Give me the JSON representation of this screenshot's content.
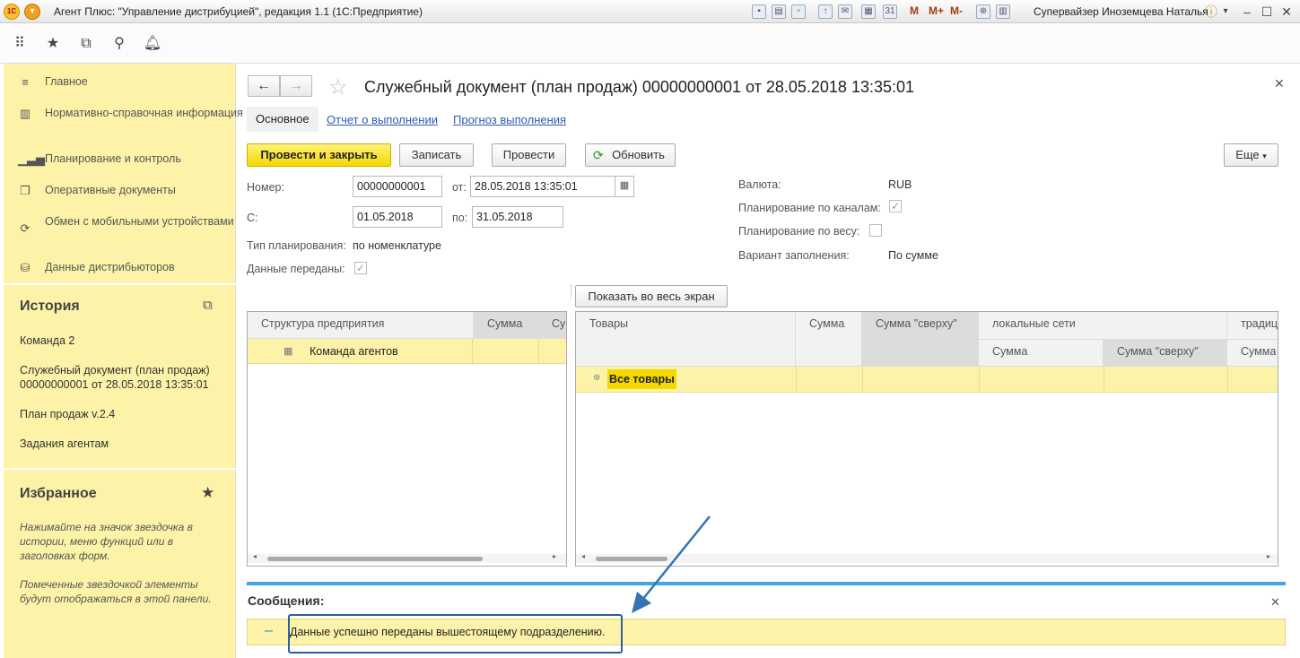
{
  "window": {
    "title": "Агент Плюс: \"Управление дистрибуцией\", редакция 1.1  (1С:Предприятие)",
    "logo_text": "1С",
    "user": "Супервайзер Иноземцева Наталья",
    "m_buttons": [
      "M",
      "M+",
      "M-"
    ]
  },
  "sidebar": {
    "items": [
      {
        "label": "Главное",
        "icon": "menu-icon"
      },
      {
        "label": "Нормативно-справочная информация",
        "icon": "reference-icon"
      },
      {
        "label": "Планирование и контроль",
        "icon": "chart-icon"
      },
      {
        "label": "Оперативные документы",
        "icon": "documents-icon"
      },
      {
        "label": "Обмен с мобильными устройствами",
        "icon": "sync-icon"
      },
      {
        "label": "Данные дистрибьюторов",
        "icon": "database-icon"
      }
    ],
    "history_title": "История",
    "history": [
      "Команда 2",
      "Служебный документ (план продаж) 00000000001 от 28.05.2018 13:35:01",
      "План продаж v.2.4",
      "Задания агентам"
    ],
    "favorites_title": "Избранное",
    "favorites_note1": "Нажимайте на значок звездочка в истории, меню функций или в заголовках форм.",
    "favorites_note2": "Помеченные звездочкой элементы будут отображаться в этой панели."
  },
  "document": {
    "title": "Служебный документ (план продаж) 00000000001 от 28.05.2018 13:35:01",
    "tabs": [
      "Основное",
      "Отчет о выполнении",
      "Прогноз выполнения"
    ],
    "buttons": {
      "post_close": "Провести и закрыть",
      "save": "Записать",
      "post": "Провести",
      "refresh": "Обновить",
      "more": "Еще"
    },
    "fields": {
      "number_label": "Номер:",
      "number": "00000000001",
      "date_label": "от:",
      "date": "28.05.2018 13:35:01",
      "from_label": "С:",
      "from": "01.05.2018",
      "to_label": "по:",
      "to": "31.05.2018",
      "plan_type_label": "Тип планирования:",
      "plan_type": "по номенклатуре",
      "sent_label": "Данные переданы:",
      "sent": true,
      "currency_label": "Валюта:",
      "currency": "RUB",
      "channel_label": "Планирование по каналам:",
      "channel": true,
      "weight_label": "Планирование по весу:",
      "weight": false,
      "fill_label": "Вариант заполнения:",
      "fill": "По сумме"
    },
    "fullscreen_button": "Показать во весь экран",
    "left_table": {
      "headers": [
        "Структура предприятия",
        "Сумма",
        "Су"
      ],
      "row": "Команда агентов"
    },
    "right_table": {
      "headers": [
        "Товары",
        "Сумма",
        "Сумма \"сверху\"",
        "локальные сети",
        "традиц"
      ],
      "subheaders": [
        "Сумма",
        "Сумма \"сверху\"",
        "Сумма"
      ],
      "row": "Все товары"
    }
  },
  "messages": {
    "title": "Сообщения:",
    "text": "Данные успешно переданы вышестоящему подразделению."
  }
}
